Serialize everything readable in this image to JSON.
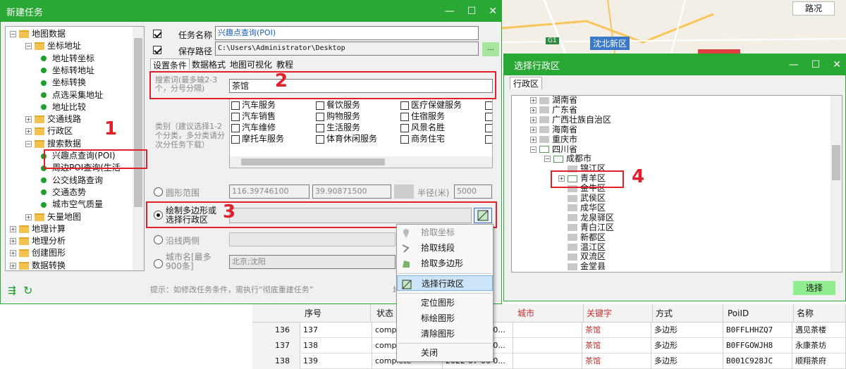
{
  "map": {
    "road_label": "路况",
    "district_label": "沈北新区",
    "badge": "G1"
  },
  "task_window": {
    "title": "新建任务",
    "tree": [
      {
        "label": "地图数据",
        "level": 0,
        "kind": "folder",
        "exp": "−"
      },
      {
        "label": "坐标地址",
        "level": 1,
        "kind": "folder",
        "exp": "−"
      },
      {
        "label": "地址转坐标",
        "level": 2,
        "kind": "dot"
      },
      {
        "label": "坐标转地址",
        "level": 2,
        "kind": "dot"
      },
      {
        "label": "坐标转换",
        "level": 2,
        "kind": "dot"
      },
      {
        "label": "点选采集地址",
        "level": 2,
        "kind": "dot"
      },
      {
        "label": "地址比较",
        "level": 2,
        "kind": "dot"
      },
      {
        "label": "交通线路",
        "level": 1,
        "kind": "folder",
        "exp": "+"
      },
      {
        "label": "行政区",
        "level": 1,
        "kind": "folder",
        "exp": "+"
      },
      {
        "label": "搜索数据",
        "level": 1,
        "kind": "folder",
        "exp": "−"
      },
      {
        "label": "兴趣点查询(POI)",
        "level": 2,
        "kind": "dot"
      },
      {
        "label": "周边POI查询(生活",
        "level": 2,
        "kind": "dot"
      },
      {
        "label": "公交线路查询",
        "level": 2,
        "kind": "dot"
      },
      {
        "label": "交通态势",
        "level": 2,
        "kind": "dot"
      },
      {
        "label": "城市空气质量",
        "level": 2,
        "kind": "dot"
      },
      {
        "label": "矢量地图",
        "level": 1,
        "kind": "folder",
        "exp": "+"
      },
      {
        "label": "地理计算",
        "level": 0,
        "kind": "folder",
        "exp": "+"
      },
      {
        "label": "地理分析",
        "level": 0,
        "kind": "folder",
        "exp": "+"
      },
      {
        "label": "创建图形",
        "level": 0,
        "kind": "folder",
        "exp": "+"
      },
      {
        "label": "数据转换",
        "level": 0,
        "kind": "folder",
        "exp": "+"
      }
    ],
    "task_name_label": "任务名称",
    "task_name_value": "兴趣点查询(POI)",
    "save_path_label": "保存路径",
    "save_path_value": "C:\\Users\\Administrator\\Desktop",
    "browse_label": "...",
    "tabs": [
      "设置条件",
      "数据格式",
      "地图可视化",
      "教程"
    ],
    "keyword_label": "搜索词(最多输2-3个，分号分隔)",
    "keyword_value": "茶馆",
    "category_label": "类别（建议选择1-2个分类，多分类请分次分任务下载）",
    "categories": [
      [
        "汽车服务",
        "餐饮服务",
        "医疗保健服务"
      ],
      [
        "汽车销售",
        "购物服务",
        "住宿服务"
      ],
      [
        "汽车维修",
        "生活服务",
        "风景名胜"
      ],
      [
        "摩托车服务",
        "体育休闲服务",
        "商务住宅"
      ]
    ],
    "circle_label": "圆形范围",
    "lng": "116.39746100",
    "lat": "39.90871500",
    "radius_label": "半径(米)",
    "radius_value": "5000",
    "polygon_label": "绘制多边形或选择行政区",
    "along_label": "沿线两侧",
    "city_label": "城市名[最多900条]",
    "city_value": "北京;沈阳",
    "hint": "提示：如修改任务条件，需执行“彻底重建任务”"
  },
  "context_menu": [
    "拾取坐标",
    "拾取线段",
    "拾取多边形",
    "选择行政区",
    "定位图形",
    "标绘图形",
    "清除图形",
    "关闭"
  ],
  "region_window": {
    "title": "选择行政区",
    "tab": "行政区",
    "tree": [
      "湖南省",
      "广东省",
      "广西壮族自治区",
      "海南省",
      "重庆市",
      "四川省",
      "成都市",
      "锦江区",
      "青羊区",
      "金牛区",
      "武侯区",
      "成华区",
      "龙泉驿区",
      "青白江区",
      "新都区",
      "温江区",
      "双流区",
      "金堂县"
    ],
    "select_button": "选择"
  },
  "table": {
    "headers": [
      "序号",
      "状态",
      "城市",
      "关键字",
      "方式",
      "PoiID",
      "名称"
    ],
    "rows": [
      {
        "idx": "136",
        "no": "137",
        "status": "complete",
        "time": "2022-07-06 0...",
        "kw": "茶馆",
        "mode": "多边形",
        "poi": "B0FFLHHZQ7",
        "name": "遇见茶楼"
      },
      {
        "idx": "137",
        "no": "138",
        "status": "complete",
        "time": "2022-07-06 0...",
        "kw": "茶馆",
        "mode": "多边形",
        "poi": "B0FFGOWJH8",
        "name": "永康茶坊"
      },
      {
        "idx": "138",
        "no": "139",
        "status": "complete",
        "time": "2022-07-06 0...",
        "kw": "茶馆",
        "mode": "多边形",
        "poi": "B001C928JC",
        "name": "顺翔茶府"
      }
    ]
  },
  "annotations": [
    "1",
    "2",
    "3",
    "4"
  ],
  "colors": {
    "title_green": "#2aa835",
    "red": "#e0202a",
    "button_green": "#90ee90"
  }
}
